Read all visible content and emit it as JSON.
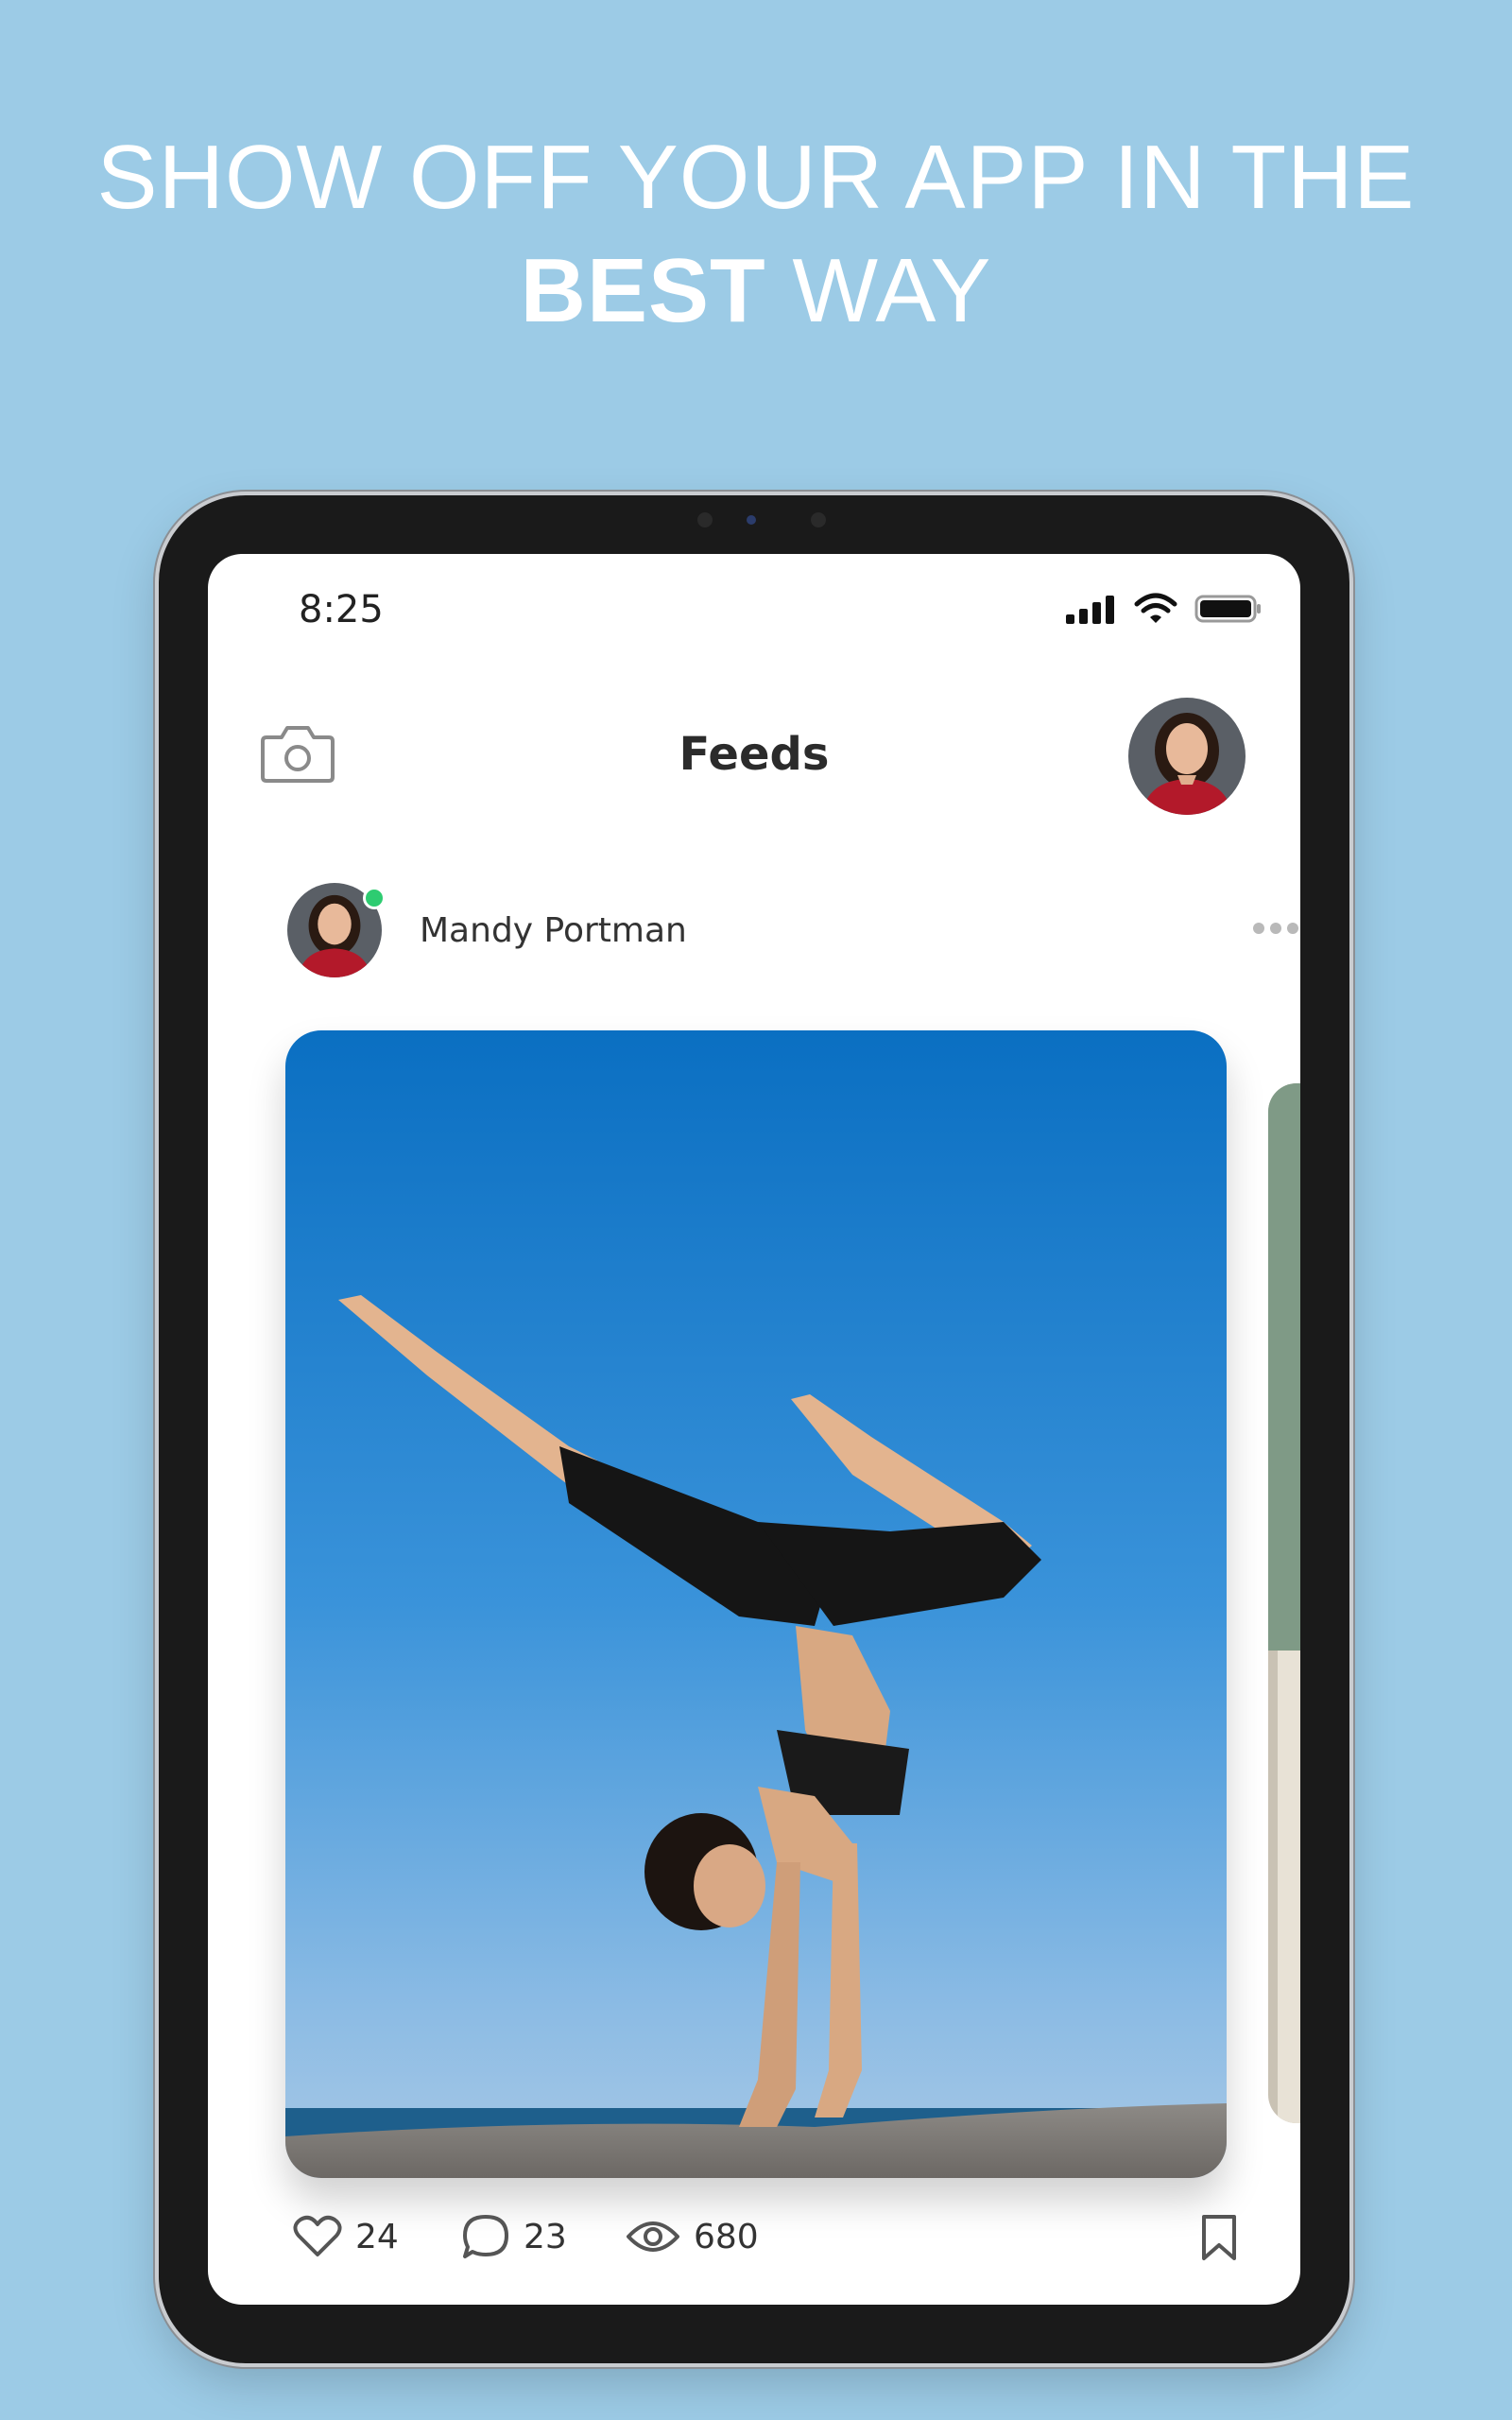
{
  "headline": {
    "line1": "SHOW OFF YOUR APP IN THE",
    "line2_bold": "BEST",
    "line2_rest": " WAY"
  },
  "status_bar": {
    "time": "8:25",
    "icons": [
      "cellular-signal-icon",
      "wifi-icon",
      "battery-icon"
    ]
  },
  "header": {
    "title": "Feeds",
    "left_icon": "camera-icon",
    "right_avatar": "profile-avatar"
  },
  "post": {
    "user_name": "Mandy Portman",
    "online": true,
    "menu_icon": "more-horizontal-icon",
    "likes": "24",
    "comments": "23",
    "views": "680"
  },
  "colors": {
    "background": "#9ccbe6",
    "online": "#2ecc71",
    "text": "#2b2b2b"
  }
}
